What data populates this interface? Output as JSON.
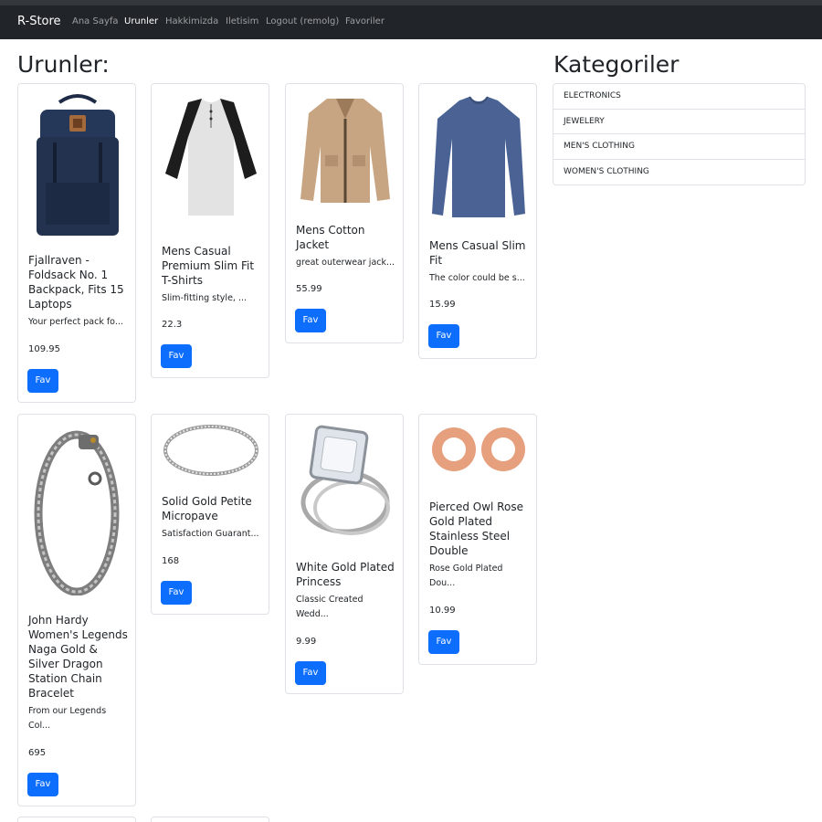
{
  "navbar": {
    "brand": "R-Store",
    "links": [
      {
        "label": "Ana Sayfa",
        "active": false
      },
      {
        "label": "Urunler",
        "active": true
      },
      {
        "label": "Hakkimizda",
        "active": false
      },
      {
        "label": "Iletisim",
        "active": false
      },
      {
        "label": "Logout (remolg)",
        "active": false
      },
      {
        "label": "Favoriler",
        "active": false
      }
    ]
  },
  "main": {
    "title": "Urunler:"
  },
  "sidebar": {
    "title": "Kategoriler",
    "categories": [
      "ELECTRONICS",
      "JEWELERY",
      "MEN'S CLOTHING",
      "WOMEN'S CLOTHING"
    ]
  },
  "products": [
    {
      "title": "Fjallraven - Foldsack No. 1 Backpack, Fits 15 Laptops",
      "desc": "Your perfect pack fo...",
      "price": "109.95",
      "button": "Fav",
      "image": "backpack-image"
    },
    {
      "title": "Mens Casual Premium Slim Fit T-Shirts",
      "desc": "Slim-fitting style, ...",
      "price": "22.3",
      "button": "Fav",
      "image": "tshirt-image"
    },
    {
      "title": "Mens Cotton Jacket",
      "desc": "great outerwear jack...",
      "price": "55.99",
      "button": "Fav",
      "image": "jacket-image"
    },
    {
      "title": "Mens Casual Slim Fit",
      "desc": "The color could be s...",
      "price": "15.99",
      "button": "Fav",
      "image": "sweater-image"
    },
    {
      "title": "John Hardy Women's Legends Naga Gold & Silver Dragon Station Chain Bracelet",
      "desc": "From our Legends Col...",
      "price": "695",
      "button": "Fav",
      "image": "bracelet-image"
    },
    {
      "title": "Solid Gold Petite Micropave",
      "desc": "Satisfaction Guarant...",
      "price": "168",
      "button": "Fav",
      "image": "ring-image"
    },
    {
      "title": "White Gold Plated Princess",
      "desc": "Classic Created Wedd...",
      "price": "9.99",
      "button": "Fav",
      "image": "princess-ring-image"
    },
    {
      "title": "Pierced Owl Rose Gold Plated Stainless Steel Double",
      "desc": "Rose Gold Plated Dou...",
      "price": "10.99",
      "button": "Fav",
      "image": "rose-gold-plugs-image"
    }
  ]
}
